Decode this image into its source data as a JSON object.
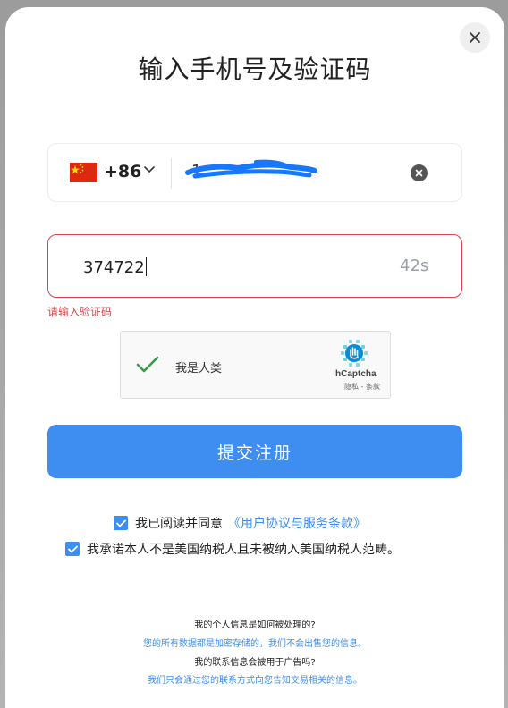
{
  "dialog": {
    "title": "输入手机号及验证码",
    "close_icon": "close-icon"
  },
  "phone": {
    "flag_icon": "china-flag-icon",
    "country_code": "+86",
    "value": "1",
    "clear_icon": "clear-circle-icon"
  },
  "verification": {
    "value": "374722",
    "countdown": "42s",
    "error": "请输入验证码"
  },
  "captcha": {
    "label": "我是人类",
    "brand": "hCaptcha",
    "links": "隐私 - 条款"
  },
  "submit_label": "提交注册",
  "agreements": {
    "terms_text": "我已阅读并同意",
    "terms_link": "《用户协议与服务条款》",
    "tax_text": "我承诺本人不是美国纳税人且未被纳入美国纳税人范畴。"
  },
  "faq": {
    "q1": "我的个人信息是如何被处理的?",
    "a1": "您的所有数据都是加密存储的，我们不会出售您的信息。",
    "q2": "我的联系信息会被用于广告吗?",
    "a2": "我们只会通过您的联系方式向您告知交易相关的信息。"
  },
  "colors": {
    "accent": "#3d8ef0",
    "error": "#d9474b",
    "check": "#3a9b48"
  }
}
